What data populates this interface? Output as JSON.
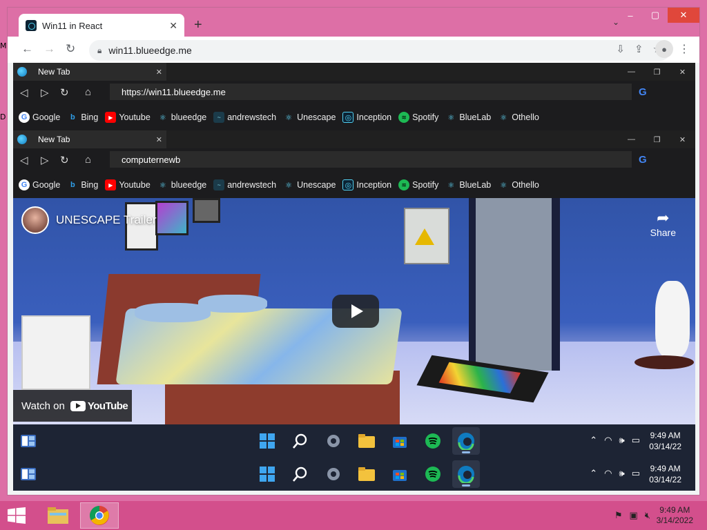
{
  "desktop": {
    "left_letters": [
      "M",
      "D"
    ]
  },
  "chrome": {
    "tab_title": "Win11 in React",
    "url": "win11.blueedge.me",
    "window_controls": [
      "–",
      "▢",
      "✕"
    ]
  },
  "browsers": [
    {
      "tab_title": "New Tab",
      "address": "https://win11.blueedge.me"
    },
    {
      "tab_title": "New Tab",
      "address": "computernewb"
    }
  ],
  "bookmarks": [
    {
      "label": "Google",
      "icon": "google-icon"
    },
    {
      "label": "Bing",
      "icon": "bing-icon"
    },
    {
      "label": "Youtube",
      "icon": "youtube-icon"
    },
    {
      "label": "blueedge",
      "icon": "react-icon"
    },
    {
      "label": "andrewstech",
      "icon": "andrewstech-icon"
    },
    {
      "label": "Unescape",
      "icon": "react-icon"
    },
    {
      "label": "Inception",
      "icon": "inception-icon"
    },
    {
      "label": "Spotify",
      "icon": "spotify-icon"
    },
    {
      "label": "BlueLab",
      "icon": "react-icon"
    },
    {
      "label": "Othello",
      "icon": "react-icon"
    }
  ],
  "video": {
    "title": "UNESCAPE Trailer",
    "share_label": "Share",
    "watch_on": "Watch on",
    "youtube_label": "YouTube"
  },
  "win11_taskbar": {
    "time": "9:49 AM",
    "date": "03/14/22",
    "apps": [
      "start-icon",
      "search-icon",
      "settings-icon",
      "file-explorer-icon",
      "store-icon",
      "spotify-icon",
      "edge-icon"
    ]
  },
  "host_taskbar": {
    "time": "9:49 AM",
    "date": "3/14/2022"
  },
  "colors": {
    "desktop_pink": "#dd6fa6",
    "taskbar_pink": "#d34f8c",
    "win11_taskbar": "#1d2434",
    "dark_browser": "#1c1c1e"
  }
}
